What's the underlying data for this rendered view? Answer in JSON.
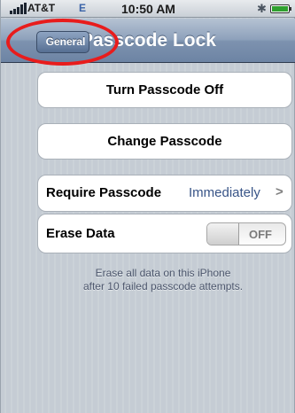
{
  "status_bar": {
    "carrier": "AT&T",
    "network": "E",
    "time": "10:50 AM",
    "icons": [
      "signal-bars-icon",
      "bluetooth-icon",
      "battery-icon"
    ]
  },
  "nav_bar": {
    "back_label": "General",
    "title": "Passcode Lock"
  },
  "rows": {
    "turn_off": {
      "label": "Turn Passcode Off"
    },
    "change": {
      "label": "Change Passcode"
    },
    "require": {
      "label": "Require Passcode",
      "value": "Immediately",
      "chevron": ">"
    },
    "erase": {
      "label": "Erase Data",
      "toggle": "OFF"
    }
  },
  "footer": {
    "line1": "Erase all data on this iPhone",
    "line2": "after 10 failed passcode attempts."
  },
  "annotation": {
    "color": "#e81c1c"
  },
  "colors": {
    "nav_bar": "#7d92af",
    "background": "#c5ccd4",
    "value_text": "#385487"
  }
}
